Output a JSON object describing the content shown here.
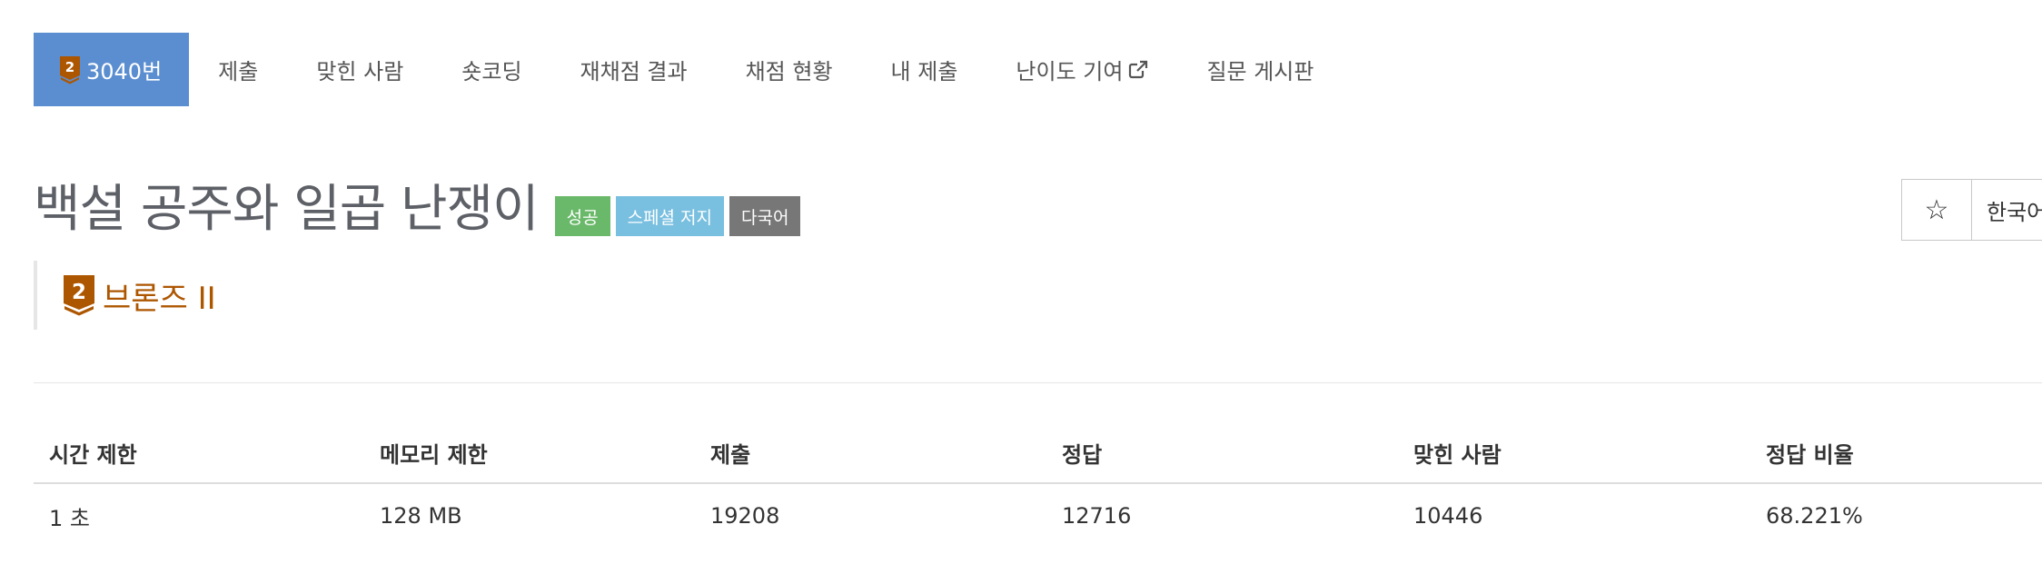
{
  "nav": {
    "problem_number": "3040번",
    "items": [
      "제출",
      "맞힌 사람",
      "숏코딩",
      "재채점 결과",
      "채점 현황",
      "내 제출",
      "난이도 기여",
      "질문 게시판"
    ]
  },
  "problem": {
    "title": "백설 공주와 일곱 난쟁이",
    "badges": [
      "성공",
      "스페셜 저지",
      "다국어"
    ],
    "tier_level": "2",
    "tier_name": "브론즈 II"
  },
  "controls": {
    "star": "☆",
    "language": "한국어"
  },
  "stats": {
    "headers": [
      "시간 제한",
      "메모리 제한",
      "제출",
      "정답",
      "맞힌 사람",
      "정답 비율"
    ],
    "values": [
      "1 초",
      "128 MB",
      "19208",
      "12716",
      "10446",
      "68.221%"
    ]
  },
  "colors": {
    "nav_active": "#5b8ed0",
    "badge_success": "#6ab96a",
    "badge_special_judge": "#79bfe0",
    "badge_multilang": "#777777",
    "bronze": "#ad5600"
  },
  "icons": {
    "tier": "bronze-tier-icon",
    "external": "external-link-icon"
  }
}
